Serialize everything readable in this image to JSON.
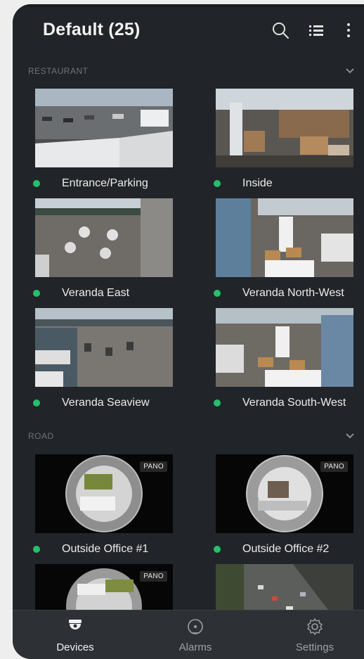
{
  "header": {
    "title": "Default (25)",
    "search_icon": "search-icon",
    "list_view_icon": "list-view-icon",
    "more_icon": "more-vertical-icon"
  },
  "sections": [
    {
      "title": "RESTAURANT",
      "cameras": [
        {
          "name": "Entrance/Parking",
          "status": "online"
        },
        {
          "name": "Inside",
          "status": "online"
        },
        {
          "name": "Veranda East",
          "status": "online"
        },
        {
          "name": "Veranda North-West",
          "status": "online"
        },
        {
          "name": "Veranda Seaview",
          "status": "online"
        },
        {
          "name": "Veranda South-West",
          "status": "online"
        }
      ]
    },
    {
      "title": "ROAD",
      "cameras": [
        {
          "name": "Outside Office #1",
          "status": "online",
          "badge": "PANO"
        },
        {
          "name": "Outside Office #2",
          "status": "online",
          "badge": "PANO"
        },
        {
          "name": "",
          "status": "",
          "badge": "PANO"
        },
        {
          "name": "",
          "status": "",
          "badge": ""
        }
      ]
    }
  ],
  "bottom_nav": [
    {
      "label": "Devices",
      "icon": "camera-icon",
      "active": true
    },
    {
      "label": "Alarms",
      "icon": "alarm-icon",
      "active": false
    },
    {
      "label": "Settings",
      "icon": "gear-icon",
      "active": false
    }
  ],
  "colors": {
    "background": "#212428",
    "status_online": "#24c06a",
    "nav_bar": "#2d3136"
  }
}
